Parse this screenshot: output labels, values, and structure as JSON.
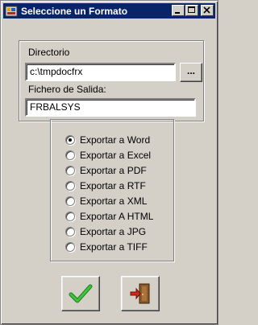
{
  "window": {
    "title": "Seleccione un Formato",
    "icon": "app-icon",
    "controls": [
      "minimize-icon",
      "maximize-icon",
      "close-icon"
    ]
  },
  "directory": {
    "label": "Directorio",
    "value": "c:\\tmpdocfrx",
    "browse_label": "..."
  },
  "output": {
    "label": "Fichero de Salida:",
    "value": "FRBALSYS"
  },
  "formats": {
    "options": [
      {
        "label": "Exportar a Word",
        "checked": true
      },
      {
        "label": "Exportar a Excel",
        "checked": false
      },
      {
        "label": "Exportar a PDF",
        "checked": false
      },
      {
        "label": "Exportar a RTF",
        "checked": false
      },
      {
        "label": "Exportar a XML",
        "checked": false
      },
      {
        "label": "Exportar A HTML",
        "checked": false
      },
      {
        "label": "Exportar a JPG",
        "checked": false
      },
      {
        "label": "Exportar a TIFF",
        "checked": false
      }
    ]
  },
  "actions": {
    "accept_icon": "checkmark-icon",
    "exit_icon": "exit-door-icon"
  },
  "colors": {
    "titlebar": "#0a246a",
    "face": "#d4d0c8",
    "accept_green": "#2ea02e",
    "exit_red": "#c8281e"
  }
}
